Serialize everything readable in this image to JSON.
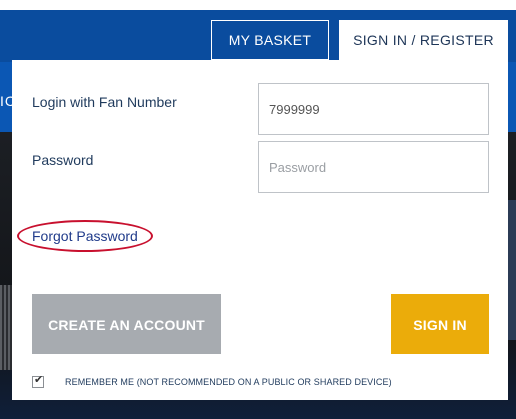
{
  "header": {
    "tabs": {
      "basket_label": "MY BASKET",
      "signin_label": "SIGN IN / REGISTER"
    },
    "nav_fragment": "IC"
  },
  "login_form": {
    "fan_number_label": "Login with Fan Number",
    "fan_number_value": "7999999",
    "password_label": "Password",
    "password_placeholder": "Password",
    "forgot_password_link": "Forgot Password",
    "create_account_button": "CREATE AN ACCOUNT",
    "sign_in_button": "SIGN IN",
    "remember_me_checked": true,
    "remember_me_label": "REMEMBER ME (NOT RECOMMENDED ON A PUBLIC OR SHARED DEVICE)"
  },
  "colors": {
    "header_blue": "#0a4c9e",
    "nav_blue": "#0b57b4",
    "create_account_gray": "#a7abb0",
    "sign_in_yellow": "#ebac0a",
    "annotation_red": "#c8102e",
    "label_navy": "#1f3a5c"
  },
  "icons": {
    "checkbox_mark": "check-icon"
  }
}
